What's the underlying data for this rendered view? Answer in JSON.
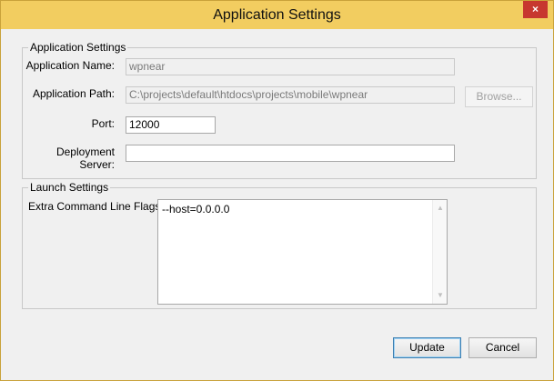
{
  "window": {
    "title": "Application Settings",
    "close_label": "×"
  },
  "app_settings": {
    "group_title": "Application Settings",
    "name_label": "Application Name:",
    "name_value": "wpnear",
    "path_label": "Application Path:",
    "path_value": "C:\\projects\\default\\htdocs\\projects\\mobile\\wpnear",
    "browse_label": "Browse...",
    "port_label": "Port:",
    "port_value": "12000",
    "server_label": "Deployment Server:",
    "server_value": ""
  },
  "launch_settings": {
    "group_title": "Launch Settings",
    "flags_label": "Extra Command Line Flags:",
    "flags_value": "--host=0.0.0.0"
  },
  "footer": {
    "update_label": "Update",
    "cancel_label": "Cancel"
  },
  "icons": {
    "scroll_up": "▲",
    "scroll_down": "▼"
  }
}
